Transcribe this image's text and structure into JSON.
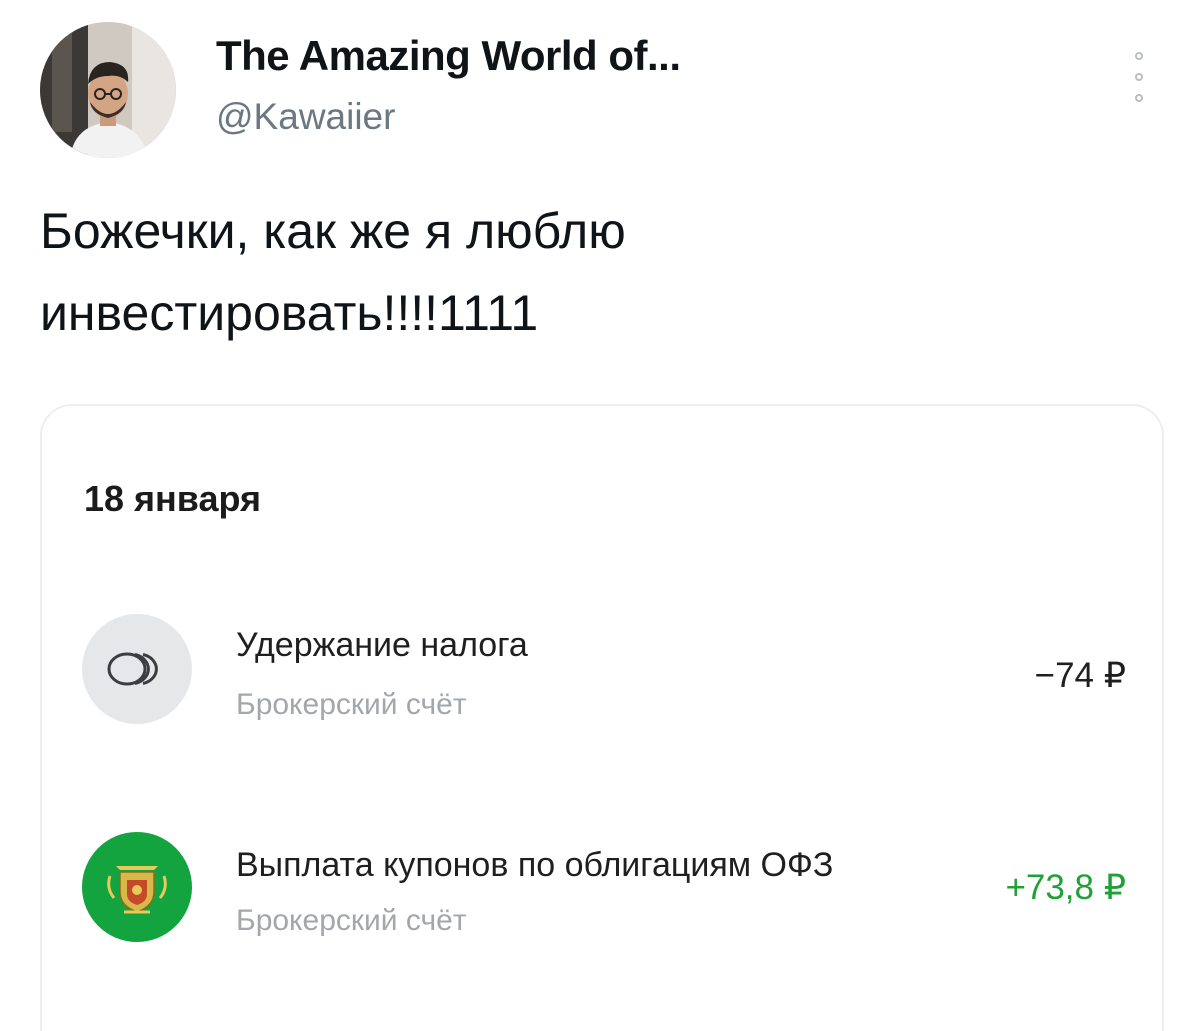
{
  "tweet": {
    "author_name": "The Amazing World of...",
    "author_handle": "@Kawaiier",
    "text_line1": "Божечки, как же я люблю",
    "text_line2": "инвестировать!!!!1111"
  },
  "card": {
    "date": "18 января",
    "operations": [
      {
        "title": "Удержание налога",
        "subtitle": "Брокерский счёт",
        "amount": "−74 ₽",
        "icon": "coins-icon"
      },
      {
        "title": "Выплата купонов по облигациям ОФЗ",
        "subtitle": "Брокерский счёт",
        "amount": "+73,8 ₽",
        "icon": "minfin-emblem-icon"
      }
    ]
  },
  "colors": {
    "text_primary": "#0f1419",
    "handle_gray": "#6b7884",
    "positive_green": "#21a038",
    "coupon_icon_bg": "#13a33f",
    "tax_icon_bg": "#e6e7e9"
  }
}
